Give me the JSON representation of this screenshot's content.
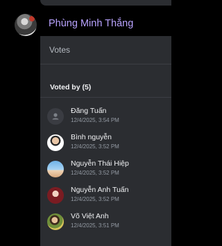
{
  "message": {
    "sender_name": "Phùng Minh Thắng"
  },
  "votes_panel": {
    "title": "Votes",
    "voted_by_label": "Voted by (5)",
    "voters": [
      {
        "name": "Đăng Tuấn",
        "time": "12/4/2025, 3:54 PM",
        "avatar": "default-user-icon"
      },
      {
        "name": "Bình nguyễn",
        "time": "12/4/2025, 3:52 PM",
        "avatar": "photo"
      },
      {
        "name": "Nguyễn Thái Hiệp",
        "time": "12/4/2025, 3:52 PM",
        "avatar": "photo"
      },
      {
        "name": "Nguyễn Anh Tuấn",
        "time": "12/4/2025, 3:52 PM",
        "avatar": "photo"
      },
      {
        "name": "Võ Việt Anh",
        "time": "12/4/2025, 3:51 PM",
        "avatar": "photo"
      }
    ]
  },
  "colors": {
    "background": "#000000",
    "panel": "#2b2d31",
    "sender_name": "#b9a3ff",
    "muted_text": "#949ba4"
  }
}
